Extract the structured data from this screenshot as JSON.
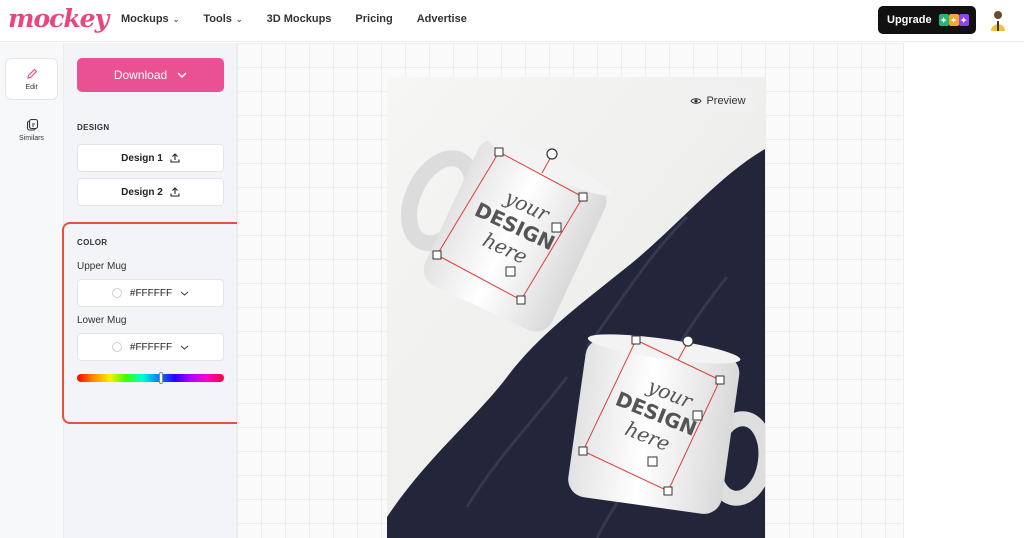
{
  "brand": {
    "logo_text": "mockey",
    "accent": "#e95192"
  },
  "nav": {
    "items": [
      {
        "label": "Mockups",
        "has_menu": true
      },
      {
        "label": "Tools",
        "has_menu": true
      },
      {
        "label": "3D Mockups",
        "has_menu": false
      },
      {
        "label": "Pricing",
        "has_menu": false
      },
      {
        "label": "Advertise",
        "has_menu": false
      }
    ],
    "upgrade_label": "Upgrade"
  },
  "rail": {
    "items": [
      {
        "label": "Edit",
        "icon": "pencil-icon",
        "active": true
      },
      {
        "label": "Similars",
        "icon": "similars-icon",
        "active": false
      }
    ]
  },
  "panel": {
    "download_label": "Download",
    "design_section": "DESIGN",
    "designs": [
      {
        "label": "Design 1"
      },
      {
        "label": "Design 2"
      }
    ],
    "color_section": "COLOR",
    "colors": [
      {
        "label": "Upper Mug",
        "value": "#FFFFFF"
      },
      {
        "label": "Lower Mug",
        "value": "#FFFFFF"
      }
    ]
  },
  "canvas": {
    "preview_label": "Preview",
    "mugs": [
      {
        "line1": "your",
        "line2": "DESIGN",
        "line3": "here"
      },
      {
        "line1": "your",
        "line2": "DESIGN",
        "line3": "here"
      }
    ]
  }
}
